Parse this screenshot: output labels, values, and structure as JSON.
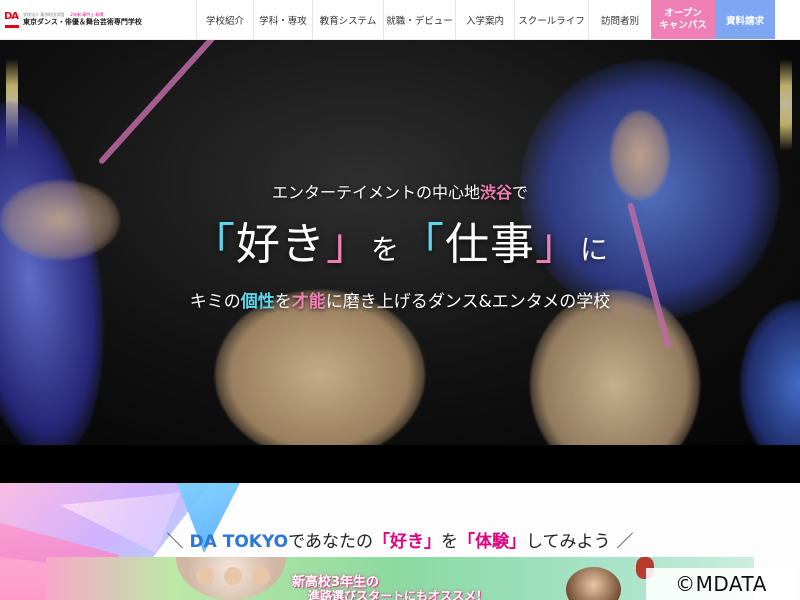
{
  "header": {
    "logo": {
      "mark": "DA",
      "sub_left": "学校法人 東京町田学園",
      "sub_right": "2年制 専門士 取得",
      "main": "東京ダンス・俳優＆舞台芸術専門学校"
    },
    "nav": [
      {
        "label": "学校紹介"
      },
      {
        "label": "学科・専攻"
      },
      {
        "label": "教育システム"
      },
      {
        "label": "就職・デビュー"
      },
      {
        "label": "入学案内"
      },
      {
        "label": "スクールライフ"
      },
      {
        "label": "訪問者別"
      }
    ],
    "open_campus": {
      "line1": "オープン",
      "line2": "キャンパス",
      "color": "#f07fb6"
    },
    "request_docs": {
      "label": "資料請求",
      "color": "#7ea6f2"
    }
  },
  "hero": {
    "tagline1": {
      "pre": "エンターテイメントの中心地",
      "highlight": "渋谷",
      "post": "で"
    },
    "tagline2": {
      "open1": "「",
      "word1": "好き",
      "close1": "」",
      "particle": "を",
      "open2": "「",
      "word2": "仕事",
      "close2": "」",
      "end": "に"
    },
    "tagline3": {
      "pre": "キミの",
      "h1": "個性",
      "mid1": "を",
      "h2": "才能",
      "post": "に磨き上げるダンス&エンタメの学校"
    }
  },
  "lower": {
    "slogan": {
      "slash_left": "＼",
      "brand": "DA TOKYO",
      "t1": "であなたの",
      "q1": "「好き」",
      "t2": "を",
      "q2": "「体験」",
      "t3": "してみよう",
      "slash_right": "／"
    },
    "banner": {
      "line1": "新高校3年生の",
      "line2": "進路選びスタートにもオススメ！"
    }
  },
  "copyright": "©MDATA",
  "colors": {
    "pink": "#f07fb6",
    "cyan": "#5cd7f0",
    "blue": "#2b78d8",
    "magenta": "#e4007f"
  }
}
